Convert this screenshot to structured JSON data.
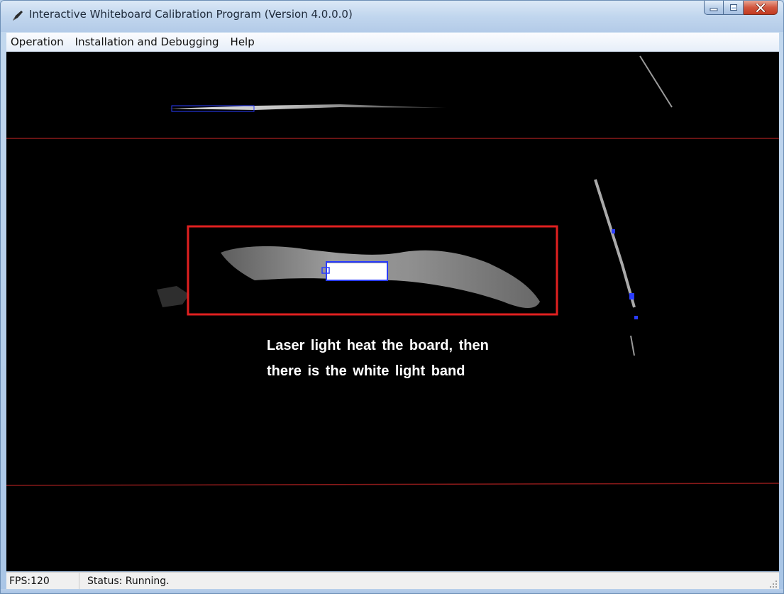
{
  "window": {
    "title": "Interactive Whiteboard Calibration Program (Version 4.0.0.0)",
    "icon": "pen-icon"
  },
  "menu": {
    "items": [
      "Operation",
      "Installation and Debugging",
      "Help"
    ]
  },
  "viewport": {
    "annotation_line1": "Laser light heat the board, then",
    "annotation_line2": "there is the white light band",
    "colors": {
      "background": "#000000",
      "boundary_line": "#8b1a1a",
      "highlight_box": "#e02020",
      "blob_marker": "#2a3cff"
    }
  },
  "statusbar": {
    "fps": "FPS:120",
    "status": "Status: Running."
  }
}
